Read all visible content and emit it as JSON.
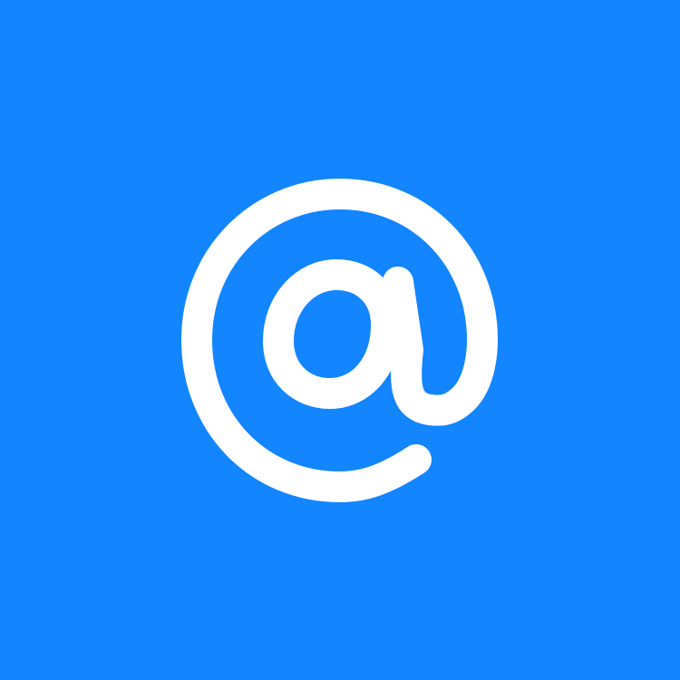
{
  "icon": {
    "name": "at-sign-icon"
  },
  "colors": {
    "background": "#1385FF",
    "glyph": "#FFFFFF"
  }
}
